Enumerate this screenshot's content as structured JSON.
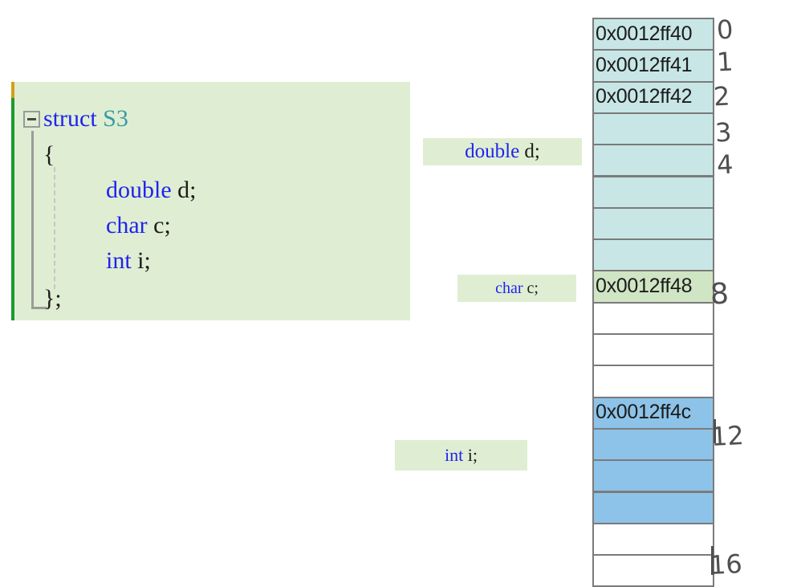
{
  "code_block": {
    "collapse_state": "expanded",
    "lines": [
      {
        "id": "struct",
        "pre": "struct ",
        "kw": "",
        "type": "S3",
        "post": ""
      },
      {
        "id": "open",
        "text": "{"
      },
      {
        "id": "double",
        "kw": "double",
        "post": " d;"
      },
      {
        "id": "char",
        "kw": "char",
        "post": " c;"
      },
      {
        "id": "int",
        "kw": "int",
        "post": " i;"
      },
      {
        "id": "close",
        "text": "};"
      }
    ],
    "keyword_struct": "struct ",
    "type_name": "S3",
    "brace_open": "{",
    "brace_close": "};",
    "member_double_kw": "double",
    "member_double_rest": " d;",
    "member_char_kw": "char",
    "member_char_rest": " c;",
    "member_int_kw": "int",
    "member_int_rest": " i;"
  },
  "labels": {
    "double": {
      "kw": "double",
      "rest": " d;"
    },
    "char": {
      "kw": "char",
      "rest": " c;"
    },
    "int": {
      "kw": "int",
      "rest": " i;"
    }
  },
  "memory": {
    "cells": [
      {
        "address": "0x0012ff40",
        "fill": "double"
      },
      {
        "address": "0x0012ff41",
        "fill": "double"
      },
      {
        "address": "0x0012ff42",
        "fill": "double"
      },
      {
        "address": "",
        "fill": "double"
      },
      {
        "address": "",
        "fill": "double"
      },
      {
        "address": "",
        "fill": "double"
      },
      {
        "address": "",
        "fill": "double"
      },
      {
        "address": "",
        "fill": "double"
      },
      {
        "address": "0x0012ff48",
        "fill": "charc"
      },
      {
        "address": "",
        "fill": "empty"
      },
      {
        "address": "",
        "fill": "empty"
      },
      {
        "address": "",
        "fill": "empty"
      },
      {
        "address": "0x0012ff4c",
        "fill": "inti"
      },
      {
        "address": "",
        "fill": "inti"
      },
      {
        "address": "",
        "fill": "inti"
      },
      {
        "address": "",
        "fill": "inti"
      },
      {
        "address": "",
        "fill": "empty"
      },
      {
        "address": "",
        "fill": "empty"
      }
    ]
  },
  "offset_notes": {
    "n0": "0",
    "n1": "1",
    "n2": "2",
    "n3": "3",
    "n4": "4",
    "n8": "8",
    "n12": "12",
    "n16": "16"
  },
  "colors": {
    "code_background": "#dfeed2",
    "label_background": "#dfeed2",
    "double_cell": "#c8e6e6",
    "char_cell": "#cfe5c3",
    "int_cell": "#8dc3e8",
    "empty_cell": "#ffffff",
    "cell_border": "#7b7b7b",
    "keyword": "#2222ee",
    "typename": "#3a9aa8",
    "gutter_modified": "#d4a017",
    "gutter_saved": "#1d9a2e",
    "handwriting": "#4f4f4f"
  }
}
